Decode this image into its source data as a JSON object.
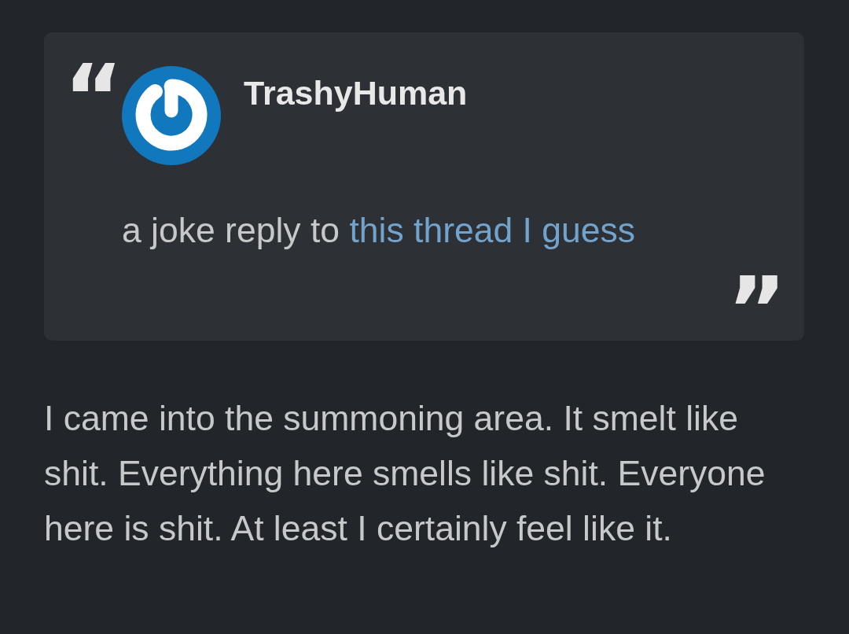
{
  "quote": {
    "open_mark": "“",
    "author": "TrashyHuman",
    "reply_text": "a joke reply to",
    "link": "this thread I guess",
    "close_mark": "”"
  },
  "paragraphs": [
    "I came into the summoning area. It smelt like shit. Everything here smells like shit. Everyone here is shit. At least I certainly feel like it."
  ]
}
